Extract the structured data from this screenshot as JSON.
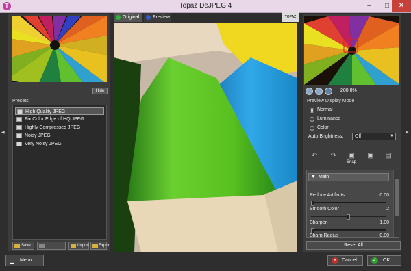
{
  "window": {
    "title": "Topaz DeJPEG 4",
    "minimize": "–",
    "maximize": "□",
    "close": "✕"
  },
  "center": {
    "tab_original": "Original",
    "tab_preview": "Preview",
    "logo": "TOPAZ"
  },
  "left": {
    "hide_label": "Hide",
    "presets_label": "Presets",
    "presets": [
      "High Quality JPEG",
      "Fix Color Edge of HQ JPEG",
      "Highly Compressed JPEG",
      "Noisy JPEG",
      "Very Noisy JPEG"
    ],
    "selected_preset": 0,
    "buttons": {
      "save": "Save",
      "import": "Import",
      "export": "Export"
    }
  },
  "right": {
    "zoom": "200.0%",
    "preview_mode_title": "Preview Display Mode",
    "modes": [
      "Normal",
      "Luminance",
      "Color"
    ],
    "selected_mode": 0,
    "auto_brightness_label": "Auto Brightness:",
    "auto_brightness_value": "Off",
    "snap_label": "Snap",
    "main_label": "Main",
    "sliders": [
      {
        "label": "Reduce Artifacts",
        "value": "0.00",
        "level": 0.0
      },
      {
        "label": "Smooth Color",
        "value": "2",
        "level": 0.5
      },
      {
        "label": "Sharpen",
        "value": "1.00",
        "level": 0.0
      },
      {
        "label": "Sharp Radius",
        "value": "0.80"
      }
    ],
    "reset_label": "Reset All"
  },
  "bottom": {
    "menu_label": "Menu...",
    "cancel_label": "Cancel",
    "ok_label": "OK"
  },
  "colors": {
    "accent_ok": "#30a030",
    "accent_cancel": "#c0302a",
    "panel": "#3c3c3c"
  }
}
